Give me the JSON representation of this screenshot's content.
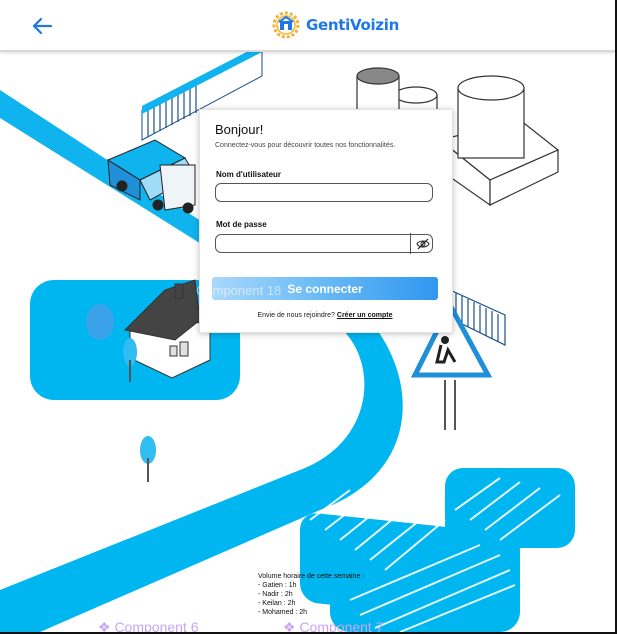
{
  "header": {
    "back_icon": "arrow-left-icon",
    "logo_icon": "gear-logo-icon",
    "brand": "GentiVoizin"
  },
  "login": {
    "greeting": "Bonjour!",
    "subtitle": "Connectez-vous pour découvrir toutes nos fonctionnalités.",
    "username_label": "Nom d'utilisateur",
    "username_value": "",
    "password_label": "Mot de passe",
    "password_value": "",
    "toggle_icon": "eye-slash-icon",
    "submit_label": "Se connecter",
    "join_text": "Envie de nous rejoindre?",
    "join_link": "Créer un compte"
  },
  "overlays": {
    "ghost_label": "Component 18",
    "component_6": "❖ Component 6",
    "component_7": "❖ Component 7"
  },
  "note": {
    "title": "Volume horaire de cette semaine :",
    "lines": [
      "- Gatien : 1h",
      "- Nadir : 2h",
      "- Keilan : 2h",
      "- Mohamed : 2h"
    ]
  },
  "colors": {
    "accent": "#1f78e6",
    "water": "#00b6f0",
    "button_end": "#2f97ef"
  }
}
